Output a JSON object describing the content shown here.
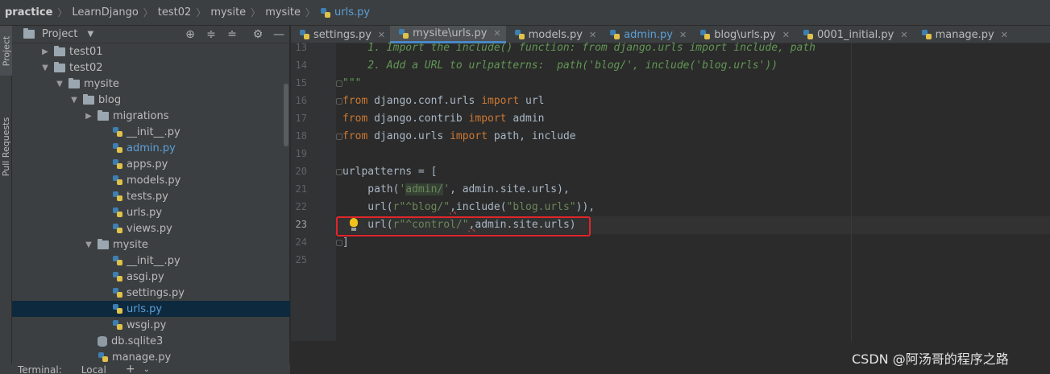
{
  "breadcrumb": [
    "practice",
    "LearnDjango",
    "test02",
    "mysite",
    "mysite",
    "urls.py"
  ],
  "left_strip": {
    "project": "Project",
    "pull_requests": "Pull Requests"
  },
  "project_panel": {
    "title": "Project",
    "tree": [
      {
        "label": "test01",
        "kind": "folder",
        "expanded": false
      },
      {
        "label": "test02",
        "kind": "folder",
        "expanded": true
      },
      {
        "label": "mysite",
        "kind": "folder",
        "expanded": true
      },
      {
        "label": "blog",
        "kind": "folder",
        "expanded": true
      },
      {
        "label": "migrations",
        "kind": "folder",
        "expanded": false
      },
      {
        "label": "__init__.py",
        "kind": "py"
      },
      {
        "label": "admin.py",
        "kind": "py",
        "modified": true
      },
      {
        "label": "apps.py",
        "kind": "py"
      },
      {
        "label": "models.py",
        "kind": "py"
      },
      {
        "label": "tests.py",
        "kind": "py"
      },
      {
        "label": "urls.py",
        "kind": "py"
      },
      {
        "label": "views.py",
        "kind": "py"
      },
      {
        "label": "mysite",
        "kind": "folder",
        "expanded": true
      },
      {
        "label": "__init__.py",
        "kind": "py"
      },
      {
        "label": "asgi.py",
        "kind": "py"
      },
      {
        "label": "settings.py",
        "kind": "py"
      },
      {
        "label": "urls.py",
        "kind": "py",
        "selected": true
      },
      {
        "label": "wsgi.py",
        "kind": "py"
      },
      {
        "label": "db.sqlite3",
        "kind": "db"
      },
      {
        "label": "manage.py",
        "kind": "py"
      }
    ]
  },
  "tabs": [
    {
      "label": "settings.py",
      "active": false
    },
    {
      "label": "mysite\\urls.py",
      "active": true
    },
    {
      "label": "models.py",
      "active": false
    },
    {
      "label": "admin.py",
      "active": false,
      "modified": true
    },
    {
      "label": "blog\\urls.py",
      "active": false
    },
    {
      "label": "0001_initial.py",
      "active": false
    },
    {
      "label": "manage.py",
      "active": false
    }
  ],
  "line_numbers": [
    "13",
    "14",
    "15",
    "16",
    "17",
    "18",
    "19",
    "20",
    "21",
    "22",
    "23",
    "24",
    "25"
  ],
  "current_line": "23",
  "code": {
    "l13": "    1. Import the include() function: from django.urls import include, path",
    "l14": "    2. Add a URL to urlpatterns:  path('blog/', include('blog.urls'))",
    "l15": "\"\"\"",
    "l16_from": "from",
    "l16_mod": " django.conf.urls ",
    "l16_import": "import",
    "l16_name": " url",
    "l17_from": "from",
    "l17_mod": " django.contrib ",
    "l17_import": "import",
    "l17_name": " admin",
    "l18_from": "from",
    "l18_mod": " django.urls ",
    "l18_import": "import",
    "l18_name": " path, include",
    "l20": "urlpatterns = [",
    "l21_a": "    path(",
    "l21_s1": "'",
    "l21_s2": "admin/",
    "l21_s3": "'",
    "l21_b": ", admin.site.urls),",
    "l22_a": "    url(",
    "l22_s": "r\"^blog/\"",
    "l22_c": ",",
    "l22_b": "include(",
    "l22_s2": "\"blog.urls\"",
    "l22_e": ")),",
    "l23_a": "    url(",
    "l23_s": "r\"^control/\"",
    "l23_c": ",",
    "l23_b": "admin.site.urls)",
    "l24": "]"
  },
  "terminal": {
    "label": "Terminal:",
    "tab": "Local",
    "add": "+",
    "more": "⌄"
  },
  "watermark": "CSDN @阿汤哥的程序之路",
  "colors": {
    "keyword": "#cc7832",
    "string": "#6a8759",
    "highlight_box": "#e0252b",
    "accent": "#4a88c7"
  }
}
